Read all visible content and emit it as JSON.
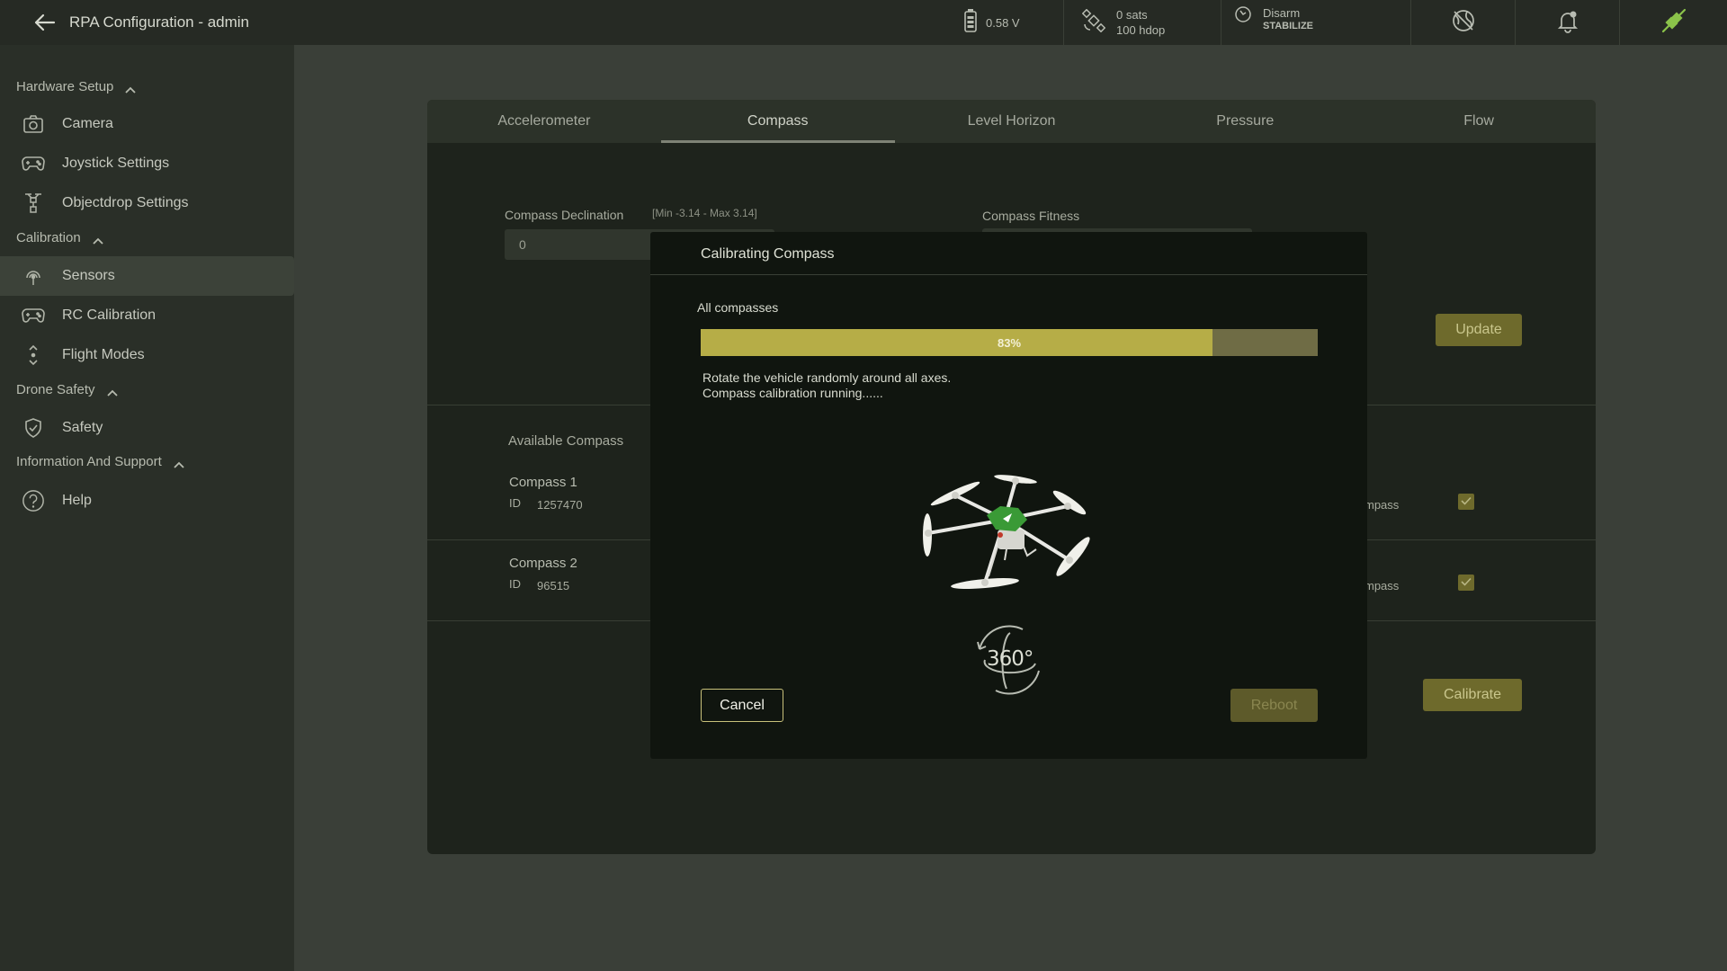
{
  "header": {
    "title": "RPA Configuration - admin",
    "battery": "0.58 V",
    "gps_sats": "0 sats",
    "gps_hdop": "100 hdop",
    "arm_status": "Disarm",
    "flight_mode": "STABILIZE"
  },
  "sidebar": {
    "sections": [
      {
        "label": "Hardware Setup"
      },
      {
        "label": "Calibration"
      },
      {
        "label": "Drone Safety"
      },
      {
        "label": "Information And Support"
      }
    ],
    "items": [
      {
        "label": "Camera",
        "icon": "camera-icon"
      },
      {
        "label": "Joystick Settings",
        "icon": "gamepad-icon"
      },
      {
        "label": "Objectdrop Settings",
        "icon": "objectdrop-icon"
      },
      {
        "label": "Sensors",
        "icon": "sensor-icon"
      },
      {
        "label": "RC Calibration",
        "icon": "gamepad-icon"
      },
      {
        "label": "Flight Modes",
        "icon": "flight-modes-icon"
      },
      {
        "label": "Safety",
        "icon": "shield-check-icon"
      },
      {
        "label": "Help",
        "icon": "help-icon"
      }
    ]
  },
  "tabs": [
    "Accelerometer",
    "Compass",
    "Level Horizon",
    "Pressure",
    "Flow"
  ],
  "compass": {
    "declination_label": "Compass Declination",
    "declination_hint": "[Min -3.14 - Max 3.14]",
    "declination_value": "0",
    "fitness_label": "Compass Fitness",
    "update_label": "Update",
    "available_label": "Available Compass",
    "items": [
      {
        "name": "Compass 1",
        "id_label": "ID",
        "id": "1257470",
        "right_label": "mpass"
      },
      {
        "name": "Compass 2",
        "id_label": "ID",
        "id": "96515",
        "right_label": "mpass"
      }
    ],
    "calibrate_label": "Calibrate"
  },
  "modal": {
    "title": "Calibrating Compass",
    "subtitle": "All compasses",
    "progress": 83,
    "progress_text": "83%",
    "message_line1": "Rotate the vehicle randomly around all axes.",
    "message_line2": "Compass calibration running......",
    "rotate_label": "360°",
    "cancel_label": "Cancel",
    "reboot_label": "Reboot"
  },
  "colors": {
    "accent": "#b6ad47",
    "drone_green": "#3a9a36",
    "link_green": "#8bc34a"
  }
}
